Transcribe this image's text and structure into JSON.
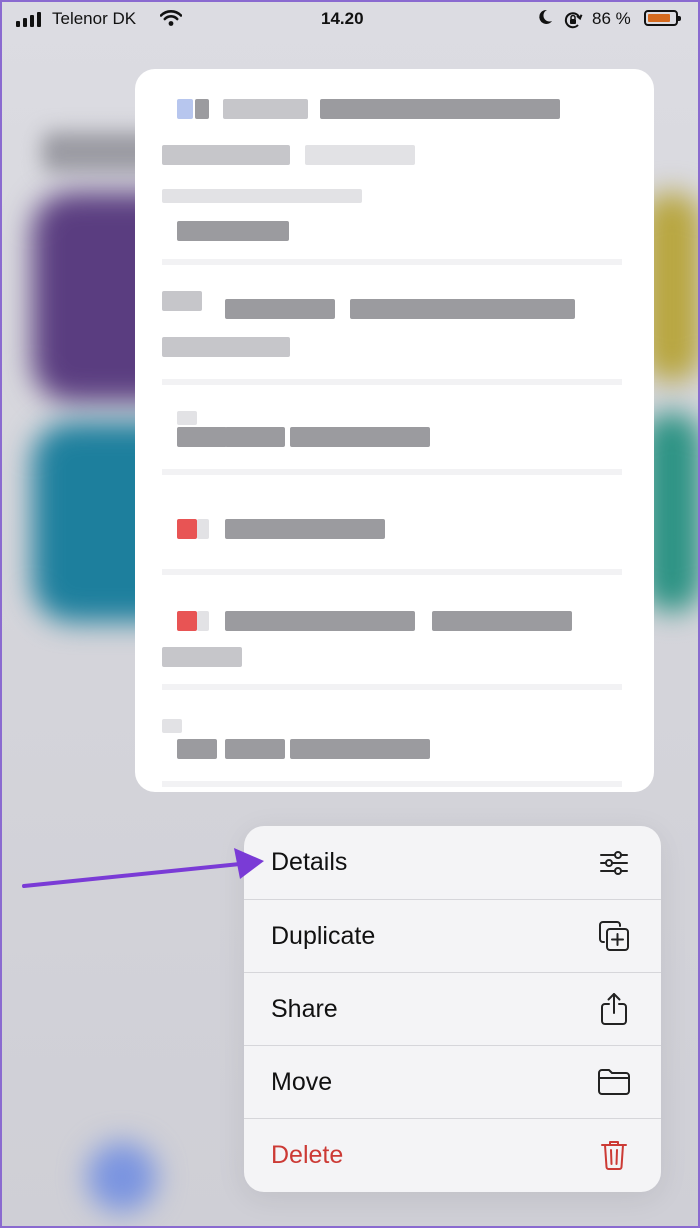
{
  "status_bar": {
    "carrier": "Telenor DK",
    "time": "14.20",
    "battery_percent": "86 %",
    "battery_level": 0.86
  },
  "menu": {
    "items": [
      {
        "label": "Details",
        "icon": "sliders-icon"
      },
      {
        "label": "Duplicate",
        "icon": "duplicate-icon"
      },
      {
        "label": "Share",
        "icon": "share-icon"
      },
      {
        "label": "Move",
        "icon": "folder-icon"
      },
      {
        "label": "Delete",
        "icon": "trash-icon"
      }
    ]
  },
  "colors": {
    "annotation_arrow": "#7a3bd6",
    "delete_red": "#cc3a35",
    "battery": "#d56a1e"
  }
}
